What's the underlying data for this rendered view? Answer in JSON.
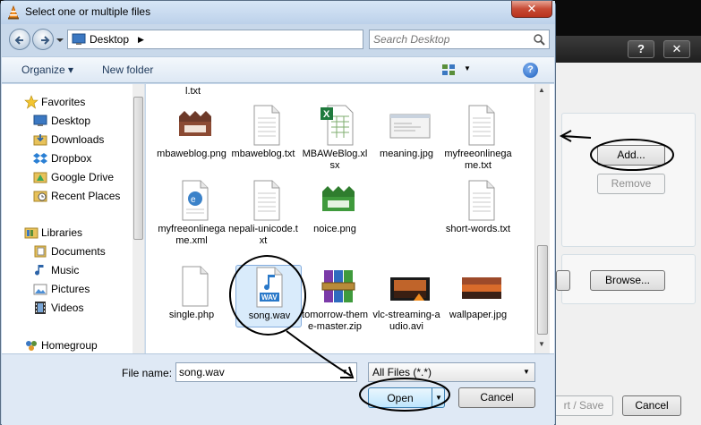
{
  "window": {
    "title": "Select one or multiple files",
    "close_symbol": "✕"
  },
  "address": {
    "location": "Desktop",
    "search_placeholder": "Search Desktop"
  },
  "toolbar": {
    "organize_label": "Organize ▾",
    "new_folder_label": "New folder",
    "help_label": "?"
  },
  "nav": {
    "favorites": "Favorites",
    "favorite_items": [
      "Desktop",
      "Downloads",
      "Dropbox",
      "Google Drive",
      "Recent Places"
    ],
    "libraries": "Libraries",
    "library_items": [
      "Documents",
      "Music",
      "Pictures",
      "Videos"
    ],
    "homegroup": "Homegroup"
  },
  "files": {
    "partial_top": "l.txt",
    "items": [
      {
        "name": "mbaweblog.png",
        "icon": "mbaweblog-logo-icon"
      },
      {
        "name": "mbaweblog.txt",
        "icon": "text-file-icon"
      },
      {
        "name": "MBAWeBlog.xlsx",
        "icon": "excel-file-icon"
      },
      {
        "name": "meaning.jpg",
        "icon": "image-thumbnail-icon"
      },
      {
        "name": "myfreeonlinegame.txt",
        "icon": "text-file-icon"
      },
      {
        "name": "myfreeonlinegame.xml",
        "icon": "xml-file-icon"
      },
      {
        "name": "nepali-unicode.txt",
        "icon": "text-file-icon"
      },
      {
        "name": "noice.png",
        "icon": "mbaweblog-green-logo-icon"
      },
      {
        "name": "",
        "icon": "blank-file-icon"
      },
      {
        "name": "short-words.txt",
        "icon": "text-file-icon"
      },
      {
        "name": "single.php",
        "icon": "blank-file-icon"
      },
      {
        "name": "song.wav",
        "icon": "wav-file-icon"
      },
      {
        "name": "tomorrow-theme-master.zip",
        "icon": "winrar-archive-icon"
      },
      {
        "name": "vlc-streaming-audio.avi",
        "icon": "video-thumbnail-icon"
      },
      {
        "name": "wallpaper.jpg",
        "icon": "sunset-thumbnail-icon"
      }
    ]
  },
  "bottom": {
    "filename_label": "File name:",
    "filename_value": "song.wav",
    "filetype_value": "All Files (*.*)",
    "open_label": "Open",
    "cancel_label": "Cancel"
  },
  "background_dialog": {
    "help_cap": "?",
    "close_cap": "✕",
    "add_label": "Add...",
    "remove_label": "Remove",
    "browse_label": "Browse...",
    "save_label": "rt / Save",
    "cancel_label": "Cancel"
  },
  "colors": {
    "title_bar": "#bcd1ea",
    "selection": "#d9ebfb",
    "close_red": "#c74a34",
    "annotation_ink": "#000000"
  }
}
